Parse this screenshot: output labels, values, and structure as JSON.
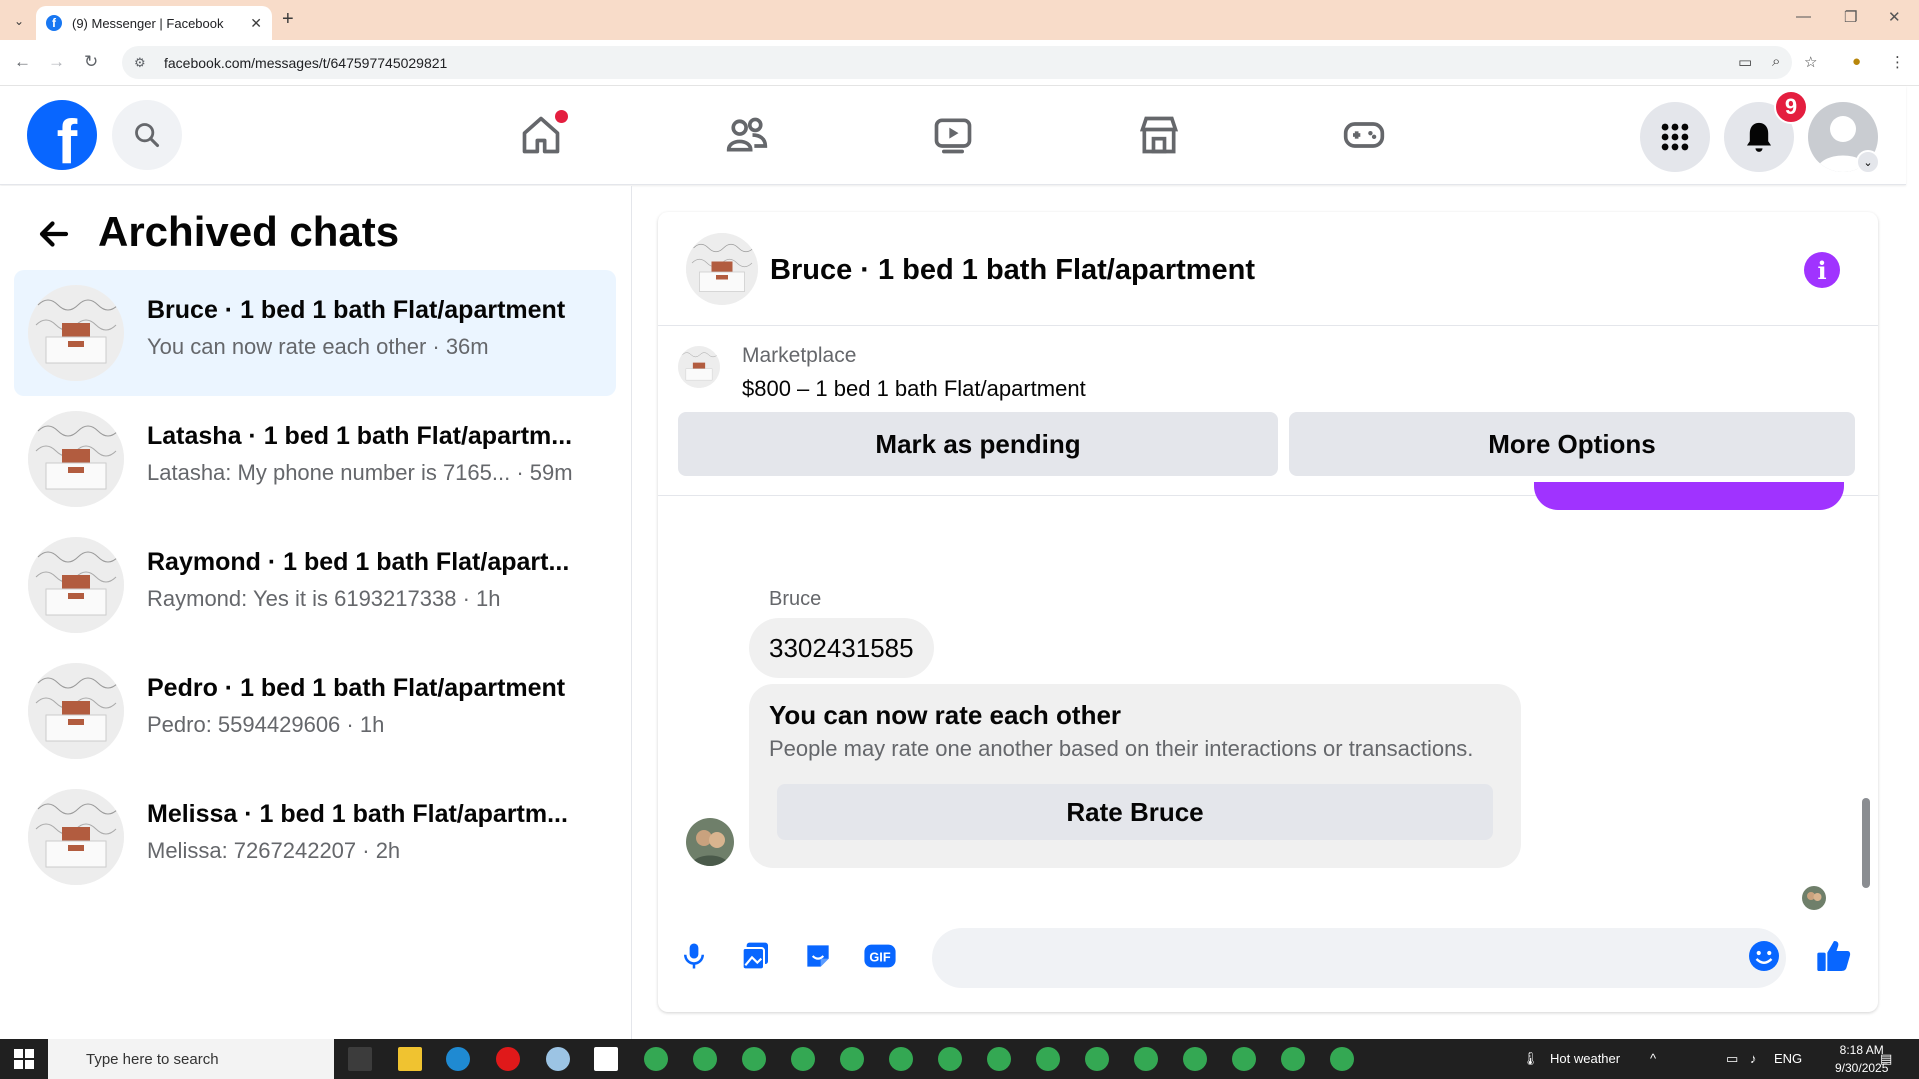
{
  "browser": {
    "tab_title": "(9) Messenger | Facebook",
    "url": "facebook.com/messages/t/647597745029821"
  },
  "fb_header": {
    "notification_count": "9",
    "nav": [
      "home-icon",
      "friends-icon",
      "watch-icon",
      "marketplace-icon",
      "gaming-icon"
    ]
  },
  "sidebar": {
    "title": "Archived chats",
    "chats": [
      {
        "name": "Bruce · 1 bed 1 bath Flat/apartment",
        "preview": "You can now rate each other · 36m",
        "active": true
      },
      {
        "name": "Latasha · 1 bed 1 bath Flat/apartm...",
        "preview": "Latasha: My phone number is 7165...  · 59m",
        "active": false
      },
      {
        "name": "Raymond · 1 bed 1 bath Flat/apart...",
        "preview": "Raymond: Yes it is 6193217338 · 1h",
        "active": false
      },
      {
        "name": "Pedro · 1 bed 1 bath Flat/apartment",
        "preview": "Pedro: 5594429606 · 1h",
        "active": false
      },
      {
        "name": "Melissa · 1 bed 1 bath Flat/apartm...",
        "preview": "Melissa: 7267242207 · 2h",
        "active": false
      }
    ]
  },
  "conversation": {
    "title": "Bruce · 1 bed 1 bath Flat/apartment",
    "marketplace": {
      "label": "Marketplace",
      "item": "$800 – 1 bed 1 bath Flat/apartment",
      "mark_pending": "Mark as pending",
      "more_options": "More Options"
    },
    "messages": {
      "sender": "Bruce",
      "bubble": "3302431585",
      "rate_title": "You can now rate each other",
      "rate_desc": "People may rate one another based on their interactions or transactions.",
      "rate_button": "Rate Bruce"
    }
  },
  "taskbar": {
    "search_placeholder": "Type here to search",
    "weather": "Hot weather",
    "lang": "ENG",
    "time": "8:18 AM",
    "date": "9/30/2025"
  },
  "colors": {
    "fb_blue": "#0866ff",
    "messenger_purple": "#a033ff",
    "active_chat": "#ebf5ff",
    "notification_red": "#e41e3f"
  }
}
